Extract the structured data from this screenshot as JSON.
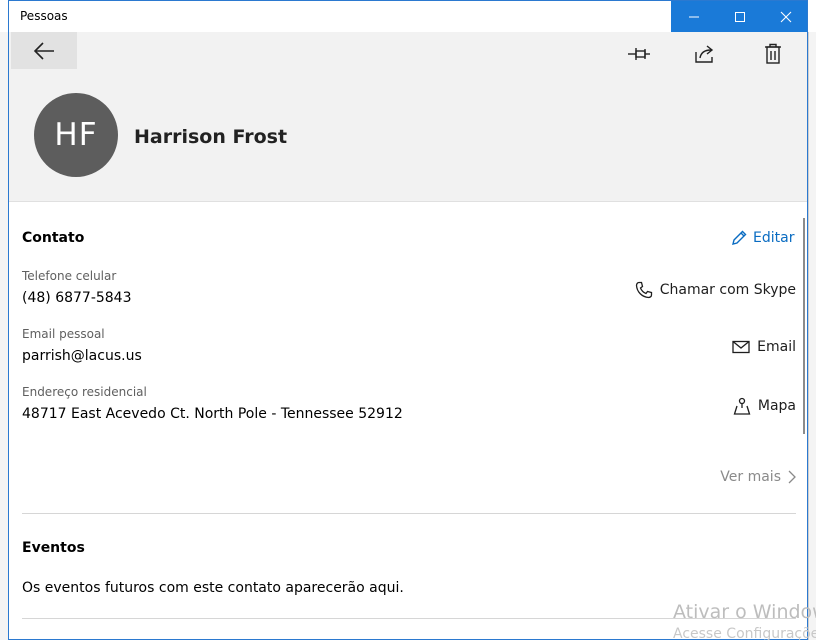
{
  "window": {
    "title": "Pessoas"
  },
  "contact": {
    "initials": "HF",
    "name": "Harrison Frost"
  },
  "contact_section": {
    "title": "Contato",
    "edit_label": "Editar",
    "fields": [
      {
        "label": "Telefone celular",
        "value": "(48) 6877-5843",
        "action": "Chamar com Skype",
        "action_icon": "phone-icon"
      },
      {
        "label": "Email pessoal",
        "value": "parrish@lacus.us",
        "action": "Email",
        "action_icon": "mail-icon"
      },
      {
        "label": "Endereço residencial",
        "value": "48717 East Acevedo Ct. North Pole - Tennessee 52912",
        "action": "Mapa",
        "action_icon": "map-pin-icon"
      }
    ],
    "see_more": "Ver mais"
  },
  "events_section": {
    "title": "Eventos",
    "empty_text": "Os eventos futuros com este contato aparecerão aqui."
  },
  "watermark": {
    "line1": "Ativar o Windows",
    "line2": "Acesse Configurações"
  },
  "colors": {
    "accent": "#1a7ad8",
    "link": "#0a6cc2",
    "avatar": "#5d5d5d",
    "header_bg": "#f2f2f2"
  }
}
